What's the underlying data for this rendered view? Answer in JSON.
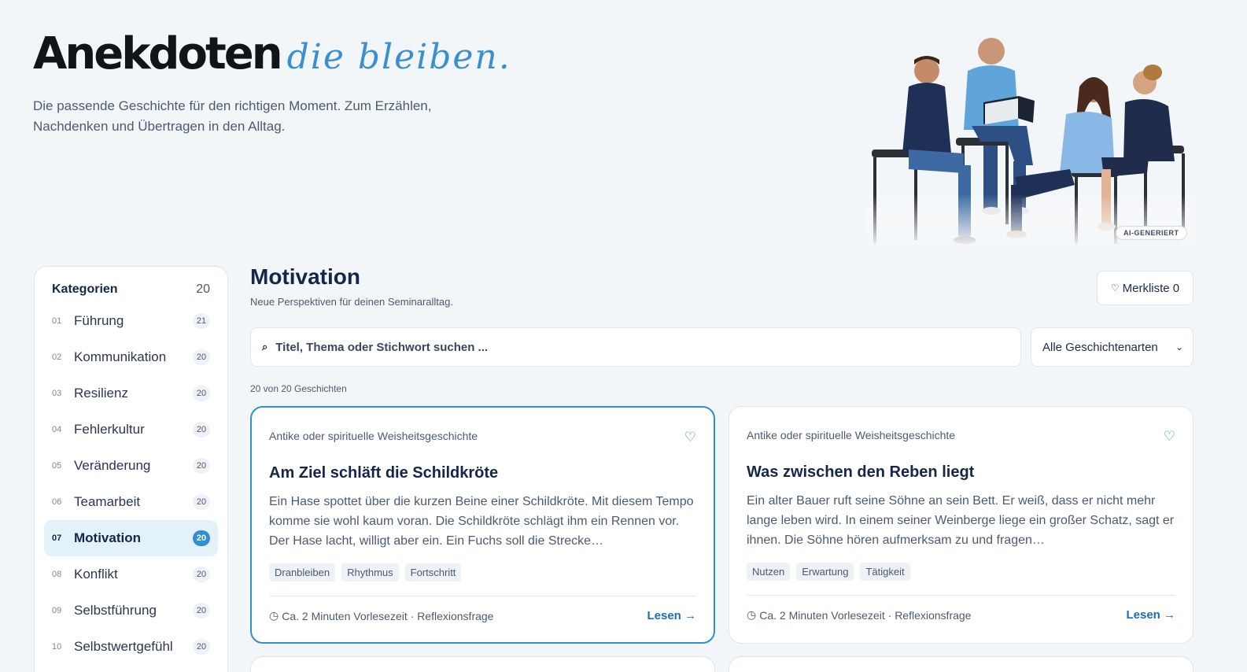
{
  "hero": {
    "title_bold": "Anekdoten",
    "title_script": "die bleiben.",
    "subtitle": "Die passende Geschichte für den richtigen Moment. Zum Erzählen, Nachdenken und Übertragen in den Alltag.",
    "ai_badge": "AI-GENERIERT"
  },
  "sidebar": {
    "title": "Kategorien",
    "count": "20",
    "items": [
      {
        "num": "01",
        "label": "Führung",
        "count": "21",
        "active": false
      },
      {
        "num": "02",
        "label": "Kommunikation",
        "count": "20",
        "active": false
      },
      {
        "num": "03",
        "label": "Resilienz",
        "count": "20",
        "active": false
      },
      {
        "num": "04",
        "label": "Fehlerkultur",
        "count": "20",
        "active": false
      },
      {
        "num": "05",
        "label": "Veränderung",
        "count": "20",
        "active": false
      },
      {
        "num": "06",
        "label": "Teamarbeit",
        "count": "20",
        "active": false
      },
      {
        "num": "07",
        "label": "Motivation",
        "count": "20",
        "active": true
      },
      {
        "num": "08",
        "label": "Konflikt",
        "count": "20",
        "active": false
      },
      {
        "num": "09",
        "label": "Selbstführung",
        "count": "20",
        "active": false
      },
      {
        "num": "10",
        "label": "Selbstwertgefühl",
        "count": "20",
        "active": false
      }
    ]
  },
  "main": {
    "title": "Motivation",
    "subtitle": "Neue Perspektiven für deinen Seminaralltag.",
    "merkliste_label": "Merkliste 0",
    "search_placeholder": "Titel, Thema oder Stichwort suchen ...",
    "filter_selected": "Alle Geschichtenarten",
    "result_count": "20 von 20 Geschichten"
  },
  "cards": [
    {
      "type": "Antike oder spirituelle Weisheitsgeschichte",
      "title": "Am Ziel schläft die Schildkröte",
      "excerpt": "Ein Hase spottet über die kurzen Beine einer Schildkröte. Mit diesem Tempo komme sie wohl kaum voran. Die Schildkröte schlägt ihm ein Rennen vor. Der Hase lacht, willigt aber ein. Ein Fuchs soll die Strecke…",
      "tags": [
        "Dranbleiben",
        "Rhythmus",
        "Fortschritt"
      ],
      "meta": "Ca. 2 Minuten Vorlesezeit · Reflexionsfrage",
      "read": "Lesen"
    },
    {
      "type": "Antike oder spirituelle Weisheitsgeschichte",
      "title": "Was zwischen den Reben liegt",
      "excerpt": "Ein alter Bauer ruft seine Söhne an sein Bett. Er weiß, dass er nicht mehr lange leben wird. In einem seiner Weinberge liege ein großer Schatz, sagt er ihnen. Die Söhne hören aufmerksam zu und fragen…",
      "tags": [
        "Nutzen",
        "Erwartung",
        "Tätigkeit"
      ],
      "meta": "Ca. 2 Minuten Vorlesezeit · Reflexionsfrage",
      "read": "Lesen"
    }
  ]
}
